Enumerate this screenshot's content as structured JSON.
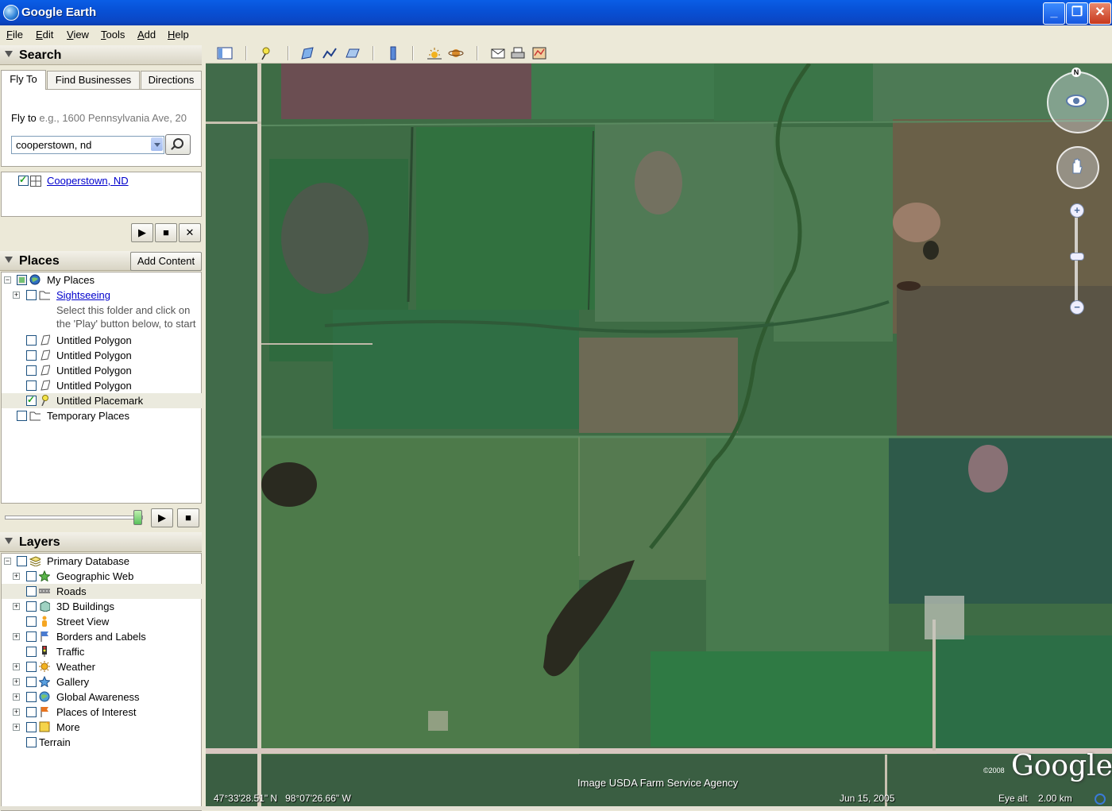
{
  "window": {
    "title": "Google Earth",
    "minimize": "_",
    "maximize": "❐",
    "close": "✕"
  },
  "menu": [
    {
      "label": "File",
      "key": "F",
      "rest": "ile"
    },
    {
      "label": "Edit",
      "key": "E",
      "rest": "dit"
    },
    {
      "label": "View",
      "key": "V",
      "rest": "iew"
    },
    {
      "label": "Tools",
      "key": "T",
      "rest": "ools"
    },
    {
      "label": "Add",
      "key": "A",
      "rest": "dd"
    },
    {
      "label": "Help",
      "key": "H",
      "rest": "elp"
    }
  ],
  "search": {
    "header": "Search",
    "tabs": [
      "Fly To",
      "Find Businesses",
      "Directions"
    ],
    "flyto_label": "Fly to",
    "flyto_hint": "e.g., 1600 Pennsylvania Ave, 20",
    "flyto_value": "cooperstown, nd",
    "result": "Cooperstown, ND",
    "controls": [
      "▶",
      "■",
      "✕"
    ]
  },
  "places": {
    "header": "Places",
    "add_content": "Add Content",
    "my_places": "My Places",
    "sightseeing": "Sightseeing",
    "sightseeing_desc_1": "Select this folder and click on",
    "sightseeing_desc_2": "the 'Play' button below, to start",
    "items": [
      "Untitled Polygon",
      "Untitled Polygon",
      "Untitled Polygon",
      "Untitled Polygon",
      "Untitled Placemark"
    ],
    "temporary": "Temporary Places",
    "controls": [
      "▶",
      "■"
    ]
  },
  "layers": {
    "header": "Layers",
    "root": "Primary Database",
    "items": [
      "Geographic Web",
      "Roads",
      "3D Buildings",
      "Street View",
      "Borders and Labels",
      "Traffic",
      "Weather",
      "Gallery",
      "Global Awareness",
      "Places of Interest",
      "More"
    ],
    "terrain": "Terrain"
  },
  "map": {
    "lat": "47°33'28.51\" N",
    "lon": "98°07'26.66\" W",
    "imagery": "Image USDA Farm Service Agency",
    "date": "Jun 15, 2005",
    "eye_alt_label": "Eye alt",
    "eye_alt_value": "2.00 km",
    "logo": "Google",
    "copyright_year": "©2008",
    "north": "N",
    "zoom_in": "+",
    "zoom_out": "−"
  }
}
